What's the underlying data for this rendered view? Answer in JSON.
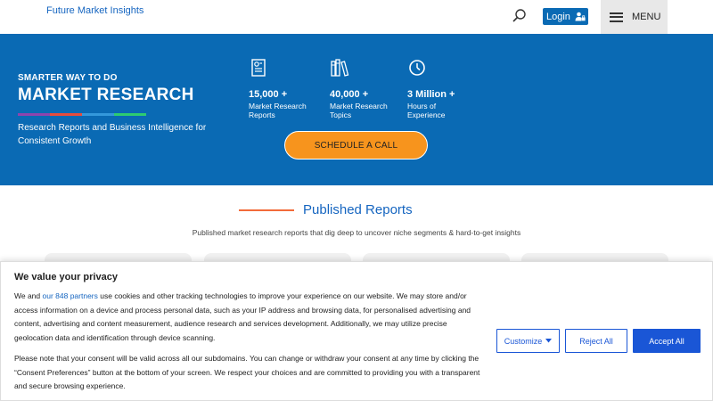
{
  "header": {
    "brand": "Future Market Insights",
    "login_label": "Login",
    "menu_label": "MENU"
  },
  "hero": {
    "eyebrow": "SMARTER WAY TO DO",
    "headline": "MARKET RESEARCH",
    "subtitle": "Research Reports and Business Intelligence for Consistent Growth",
    "stats": [
      {
        "icon": "report-document-icon",
        "value": "15,000 +",
        "label_line1": "Market Research",
        "label_line2": "Reports"
      },
      {
        "icon": "books-icon",
        "value": "40,000 +",
        "label_line1": "Market Research",
        "label_line2": "Topics"
      },
      {
        "icon": "clock-icon",
        "value": "3 Million +",
        "label_line1": "Hours of",
        "label_line2": "Experience"
      }
    ],
    "cta_label": "SCHEDULE A CALL",
    "rainbow_colors": [
      "#8e44ad",
      "#e74c3c",
      "#3498db",
      "#2ecc71"
    ],
    "accent_color": "#f7941d",
    "background_color": "#0a6ab4"
  },
  "section": {
    "title": "Published Reports",
    "description": "Published market research reports that dig deep to uncover niche segments & hard-to-get insights"
  },
  "consent": {
    "title": "We value your privacy",
    "p1_before": "We and ",
    "p1_link": "our 848 partners",
    "p1_after": " use cookies and other tracking technologies to improve your experience on our website. We may store and/or access information on a device and process personal data, such as your IP address and browsing data, for personalised advertising and content, advertising and content measurement, audience research and services development. Additionally, we may utilize precise geolocation data and identification through device scanning.",
    "p2": "Please note that your consent will be valid across all our subdomains. You can change or withdraw your consent at any time by clicking the “Consent Preferences” button at the bottom of your screen. We respect your choices and are committed to providing you with a transparent and secure browsing experience.",
    "customize_label": "Customize",
    "reject_label": "Reject All",
    "accept_label": "Accept All"
  }
}
